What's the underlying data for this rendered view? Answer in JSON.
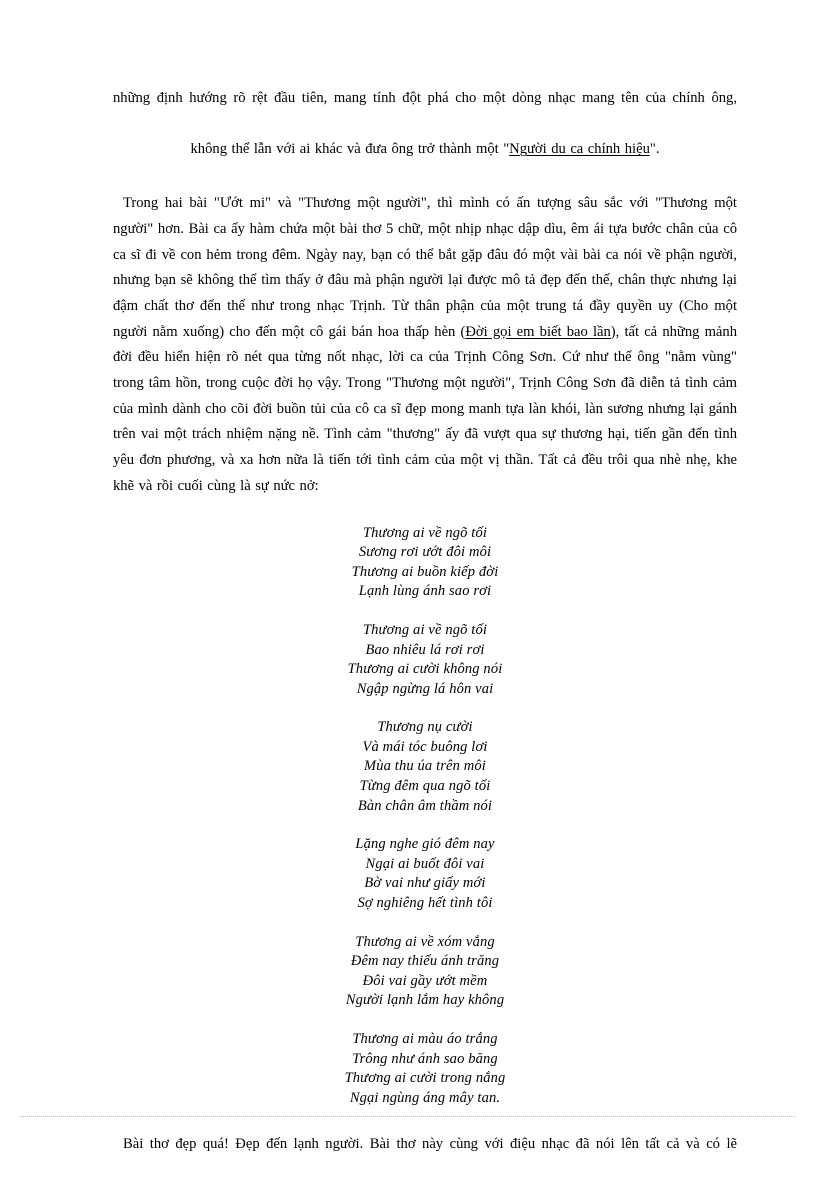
{
  "document": {
    "paragraph_intro": {
      "line1": "những định hướng rõ rệt đầu tiên, mang tính đột phá cho một dòng nhạc mang tên của chính ông,",
      "line2_before": "không thể lẫn với ai khác và đưa ông trở thành một \"",
      "line2_link": "Người du ca chính hiệu",
      "line2_after": "\"."
    },
    "paragraph_main": {
      "seg1": "Trong hai bài \"Ướt mi\" và \"Thương một người\", thì mình có ấn tượng sâu sắc với \"Thương một người\" hơn. Bài ca ấy hàm chứa một bài thơ 5 chữ, một nhịp nhạc dập dìu, êm ái tựa bước chân của cô ca sĩ đi về con hẻm trong đêm. Ngày nay, bạn có thể bắt gặp đâu đó một vài bài ca nói về phận người, nhưng bạn sẽ không thể tìm thấy ở đâu mà phận người lại được mô tả đẹp đến thế, chân thực nhưng lại đậm chất thơ đến thế như trong nhạc Trịnh. Từ thân phận của một trung tá đầy quyền uy (Cho một người nằm xuống) cho đến một cô gái bán hoa thấp hèn (",
      "link1": "Đời gọi em biết bao lần",
      "seg2": "), tất cả những mảnh đời đều hiển hiện rõ nét qua từng nốt nhạc, lời ca của Trịnh Công Sơn. Cứ như thể ông \"nằm vùng\" trong tâm hồn, trong cuộc đời họ vậy. Trong \"Thương một người\", Trịnh Công Sơn đã diễn tả tình cảm của mình dành cho cõi đời buồn tủi của cô ca sĩ đẹp mong manh tựa làn khói, làn sương nhưng lại gánh trên vai một trách nhiệm nặng nề. Tình cảm \"thương\" ấy đã vượt qua sự thương hại, tiến gần đến tình yêu đơn phương, và xa hơn nữa là tiến tới tình cảm của một vị thần. Tất cả đều trôi qua nhè nhẹ, khe khẽ và rồi cuối cùng là sự nức nở:"
    },
    "poem": {
      "stanzas": [
        {
          "lines": [
            "Thương ai về ngõ tối",
            "Sương rơi ướt đôi môi",
            "Thương ai buồn kiếp đời",
            "Lạnh lùng ánh sao rơi"
          ]
        },
        {
          "lines": [
            "Thương ai về ngõ tối",
            "Bao nhiêu lá rơi rơi",
            "Thương ai cười không nói",
            "Ngập ngừng lá hôn vai"
          ]
        },
        {
          "lines": [
            "Thương nụ cười",
            "Và mái tóc buông lơi",
            "Mùa thu úa trên môi",
            "Từng đêm qua ngõ tối",
            "Bàn chân âm thầm nói"
          ]
        },
        {
          "lines": [
            "Lặng nghe gió đêm nay",
            "Ngại ai buốt đôi vai",
            "Bờ vai như giấy mới",
            "Sợ nghiêng hết tình tôi"
          ]
        },
        {
          "lines": [
            "Thương ai về xóm vắng",
            "Đêm nay thiếu ánh trăng",
            "Đôi vai gầy ướt mềm",
            "Người lạnh lắm hay không"
          ]
        },
        {
          "lines": [
            "Thương ai màu áo trắng",
            "Trông như ánh sao băng",
            "Thương ai cười trong nắng",
            "Ngại ngùng áng mây tan."
          ]
        }
      ]
    },
    "paragraph_closing": {
      "text": "Bài thơ đẹp quá! Đẹp đến lạnh người. Bài thơ này cùng với điệu nhạc đã nói lên tất cả và có lẽ"
    }
  }
}
